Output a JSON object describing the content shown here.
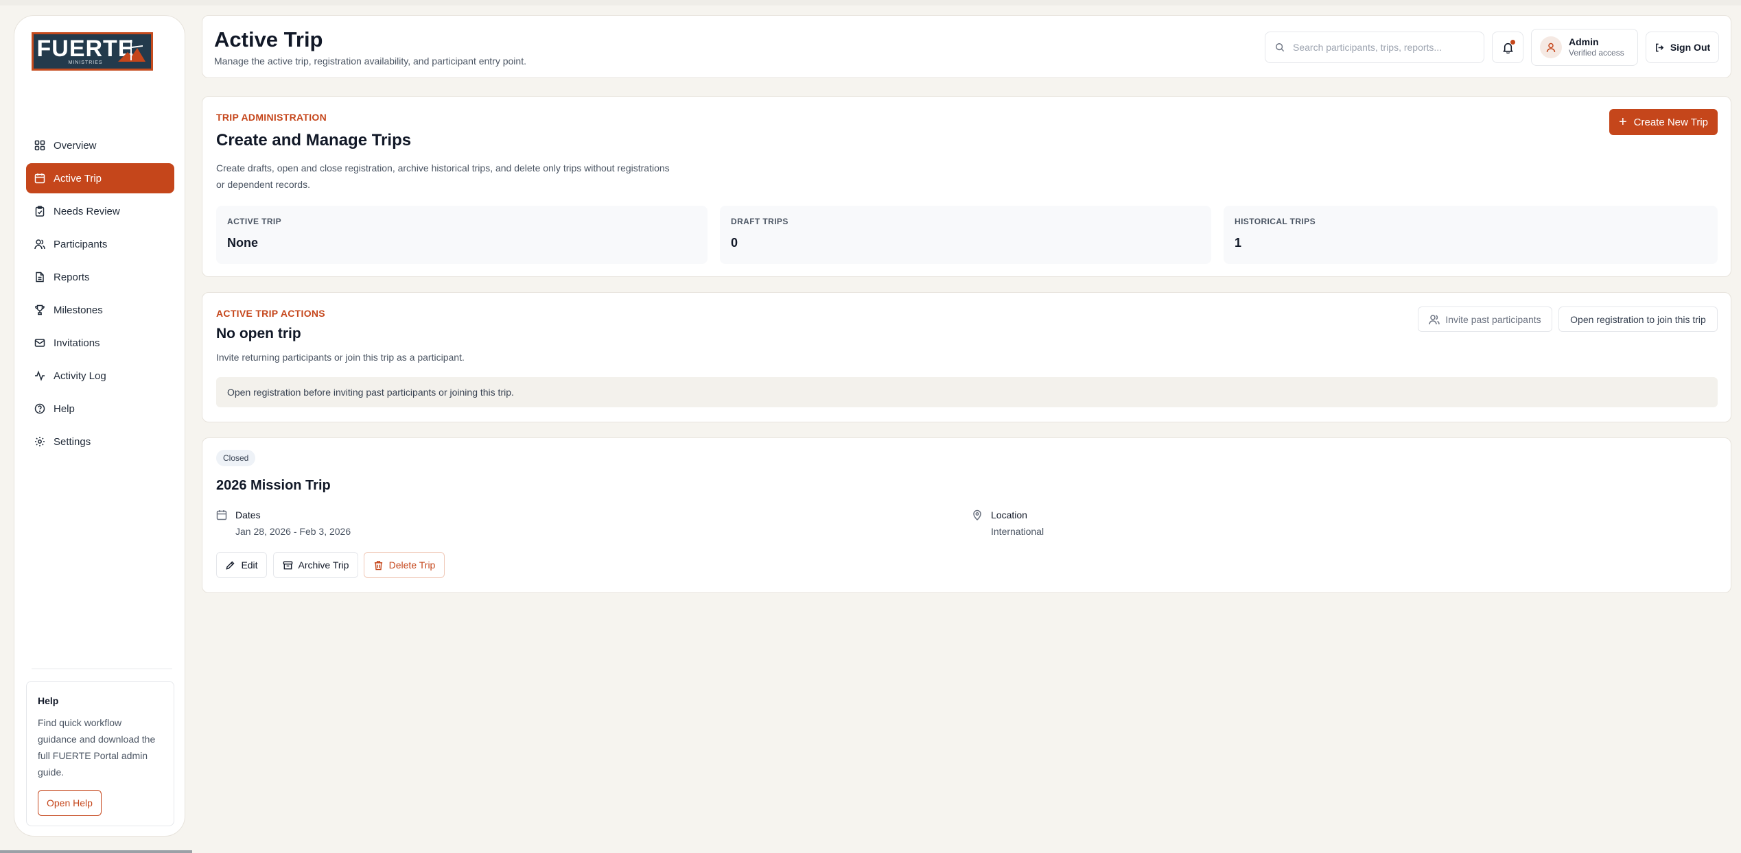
{
  "brand": {
    "logo_word": "FUERTE",
    "logo_sub": "MINISTRIES",
    "accent": "#c5461b",
    "navy": "#233a4c"
  },
  "sidebar": {
    "items": [
      {
        "label": "Overview",
        "icon": "grid-icon"
      },
      {
        "label": "Active Trip",
        "icon": "calendar-icon",
        "active": true
      },
      {
        "label": "Needs Review",
        "icon": "clipboard-icon"
      },
      {
        "label": "Participants",
        "icon": "users-icon"
      },
      {
        "label": "Reports",
        "icon": "document-icon"
      },
      {
        "label": "Milestones",
        "icon": "trophy-icon"
      },
      {
        "label": "Invitations",
        "icon": "mail-icon"
      },
      {
        "label": "Activity Log",
        "icon": "activity-icon"
      },
      {
        "label": "Help",
        "icon": "help-circle-icon"
      },
      {
        "label": "Settings",
        "icon": "gear-icon"
      }
    ],
    "help": {
      "title": "Help",
      "text": "Find quick workflow guidance and download the full FUERTE Portal admin guide.",
      "button": "Open Help"
    }
  },
  "header": {
    "title": "Active Trip",
    "subtitle": "Manage the active trip, registration availability, and participant entry point.",
    "search_placeholder": "Search participants, trips, reports...",
    "user_name": "Admin",
    "user_role": "Verified access",
    "sign_out": "Sign Out"
  },
  "admin_section": {
    "eyebrow": "TRIP ADMINISTRATION",
    "title": "Create and Manage Trips",
    "description_line1": "Create drafts, open and close registration, archive historical trips, and delete only trips without registrations",
    "description_line2": "or dependent records.",
    "create_button": "Create New Trip",
    "stats": [
      {
        "label": "ACTIVE TRIP",
        "value": "None"
      },
      {
        "label": "DRAFT TRIPS",
        "value": "0"
      },
      {
        "label": "HISTORICAL TRIPS",
        "value": "1"
      }
    ]
  },
  "actions_section": {
    "eyebrow": "ACTIVE TRIP ACTIONS",
    "title": "No open trip",
    "description": "Invite returning participants or join this trip as a participant.",
    "invite_button": "Invite past participants",
    "open_button": "Open registration to join this trip",
    "notice": "Open registration before inviting past participants or joining this trip."
  },
  "trip": {
    "status": "Closed",
    "name": "2026 Mission Trip",
    "dates_label": "Dates",
    "dates_value": "Jan 28, 2026 - Feb 3, 2026",
    "location_label": "Location",
    "location_value": "International",
    "edit_button": "Edit",
    "archive_button": "Archive Trip",
    "delete_button": "Delete Trip"
  }
}
